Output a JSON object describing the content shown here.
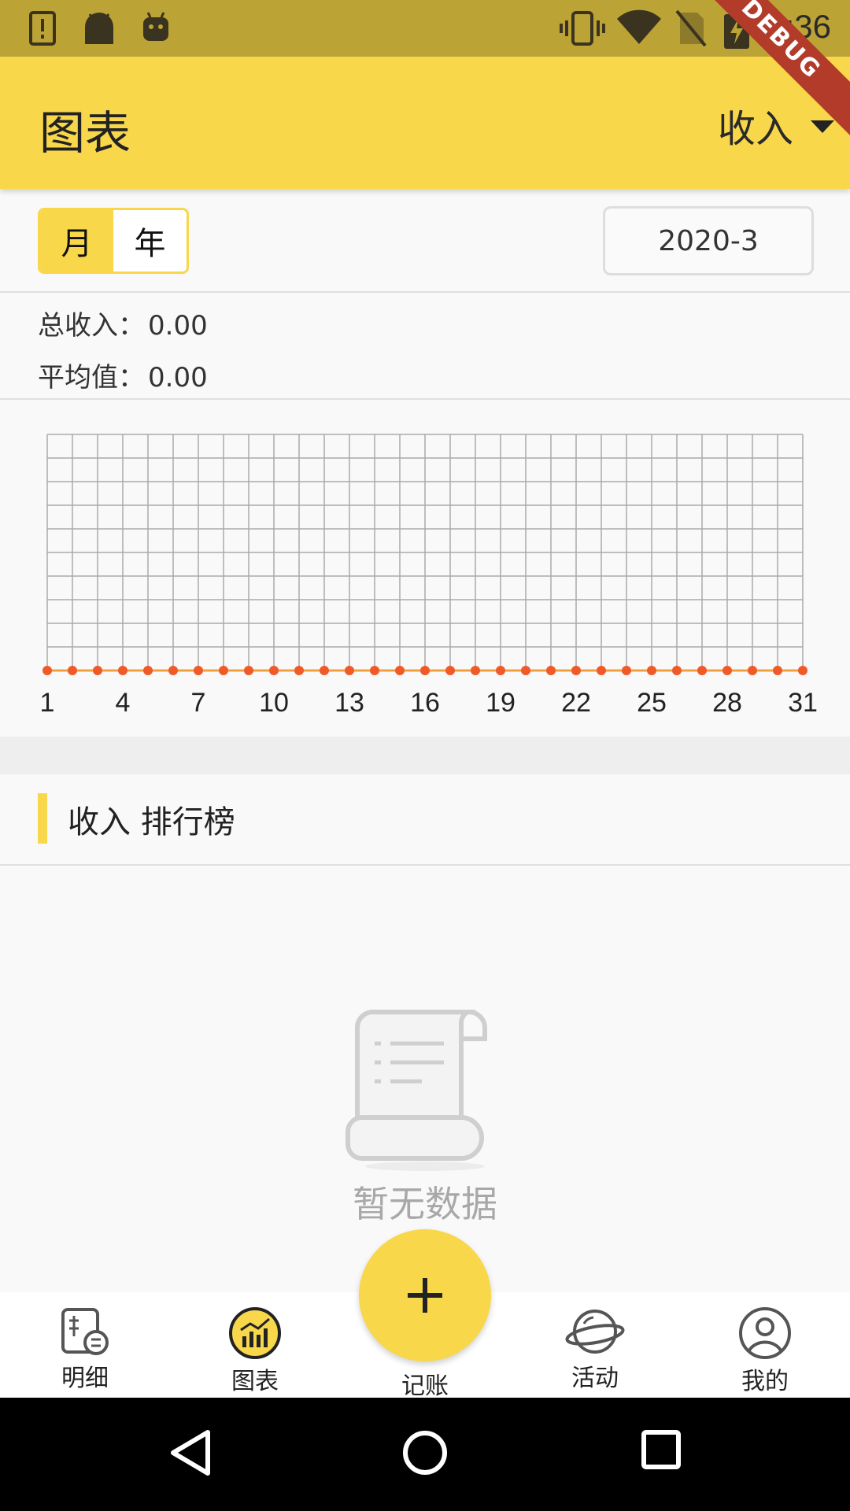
{
  "status_bar": {
    "time": "2:36",
    "icons": [
      "alert-icon",
      "android-icon",
      "android-robot-icon",
      "vibrate-icon",
      "wifi-icon",
      "no-sim-icon",
      "battery-charging-icon"
    ]
  },
  "debug_banner": "DEBUG",
  "app_bar": {
    "title": "图表",
    "type_selector": "收入"
  },
  "period": {
    "month_label": "月",
    "year_label": "年",
    "active": "月",
    "date_value": "2020-3"
  },
  "summary": {
    "total_label": "总收入：",
    "total_value": "0.00",
    "average_label": "平均值：",
    "average_value": "0.00"
  },
  "chart_data": {
    "type": "line",
    "x": [
      1,
      2,
      3,
      4,
      5,
      6,
      7,
      8,
      9,
      10,
      11,
      12,
      13,
      14,
      15,
      16,
      17,
      18,
      19,
      20,
      21,
      22,
      23,
      24,
      25,
      26,
      27,
      28,
      29,
      30,
      31
    ],
    "y": [
      0,
      0,
      0,
      0,
      0,
      0,
      0,
      0,
      0,
      0,
      0,
      0,
      0,
      0,
      0,
      0,
      0,
      0,
      0,
      0,
      0,
      0,
      0,
      0,
      0,
      0,
      0,
      0,
      0,
      0,
      0
    ],
    "x_tick_labels": [
      "1",
      "4",
      "7",
      "10",
      "13",
      "16",
      "19",
      "22",
      "25",
      "28",
      "31"
    ],
    "grid": true,
    "line_color": "#f4a03a",
    "point_color": "#f05a28"
  },
  "ranking": {
    "title": "收入 排行榜"
  },
  "empty_state": {
    "text": "暂无数据",
    "icon": "scroll-document-icon"
  },
  "bottom_nav": {
    "items": [
      {
        "label": "明细",
        "icon": "ledger-icon"
      },
      {
        "label": "图表",
        "icon": "chart-icon"
      },
      {
        "label": "活动",
        "icon": "planet-icon"
      },
      {
        "label": "我的",
        "icon": "person-icon"
      }
    ],
    "fab_label": "记账",
    "active": "图表"
  },
  "colors": {
    "accent": "#f8d74a",
    "status_bar": "#bca335"
  }
}
